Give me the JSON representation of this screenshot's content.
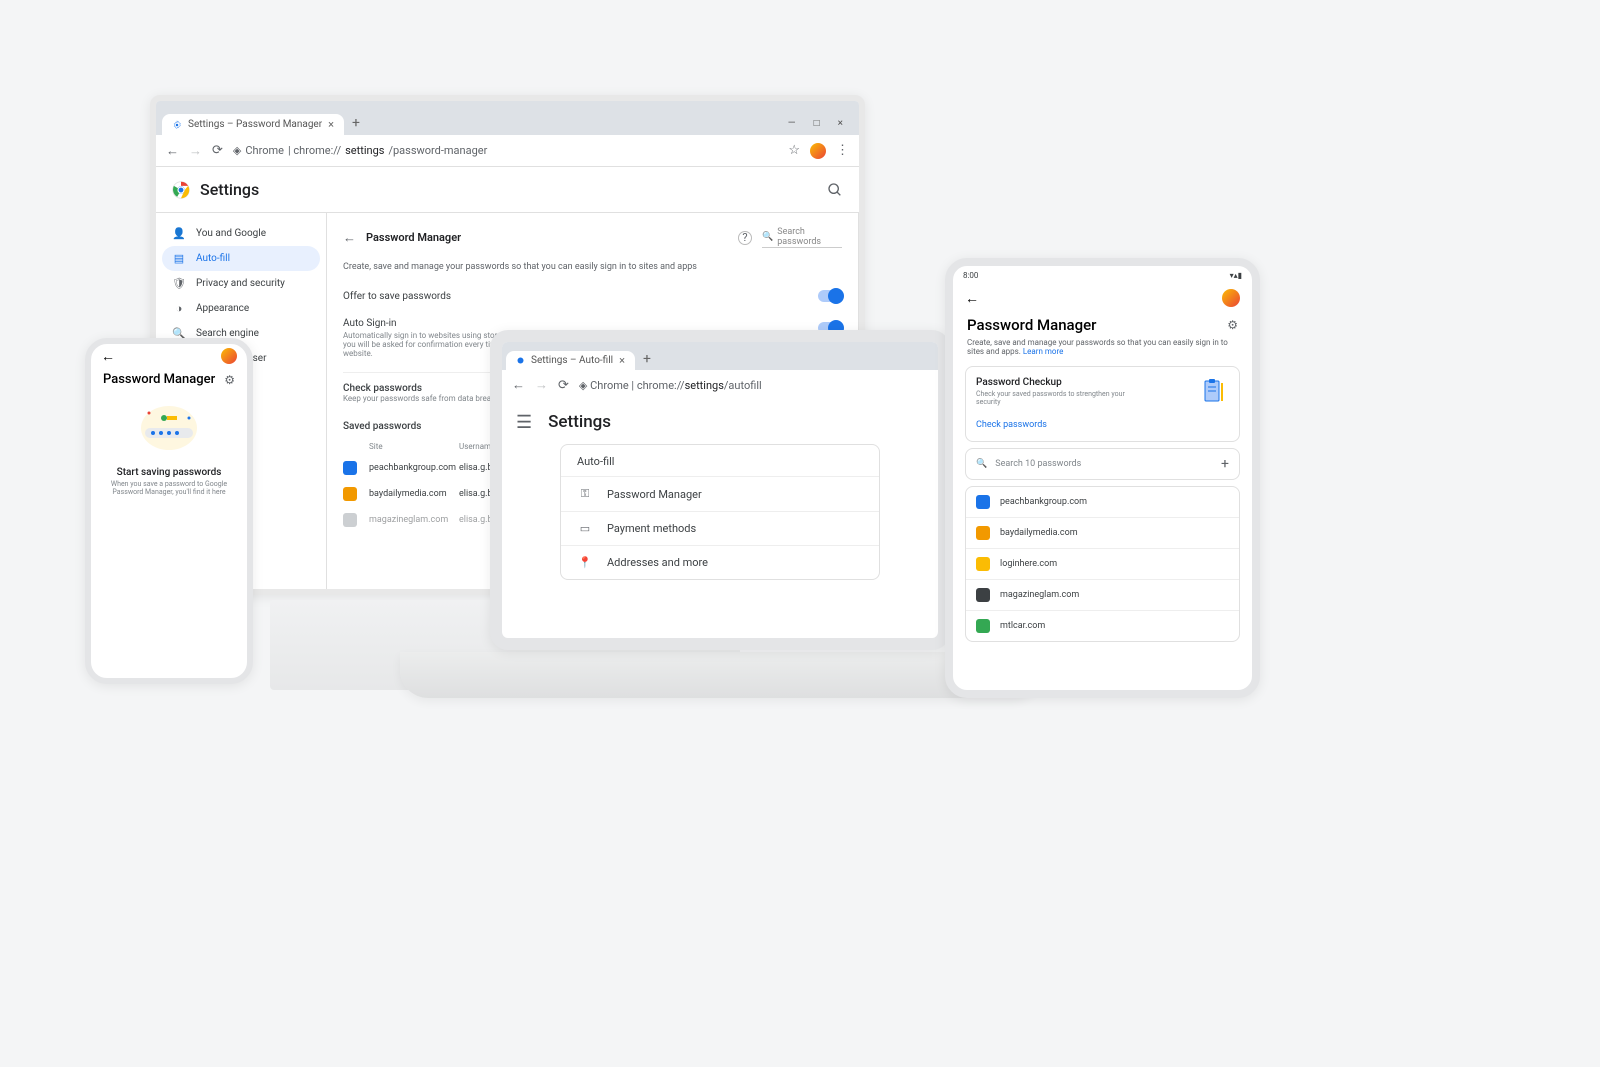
{
  "desktop": {
    "tab_title": "Settings – Password Manager",
    "url_prefix": "Chrome",
    "url_sep": " | chrome://",
    "url_bold": "settings",
    "url_suffix": "/password-manager",
    "app_title": "Settings",
    "sidebar": {
      "items": [
        {
          "icon": "person",
          "label": "You and Google"
        },
        {
          "icon": "autofill",
          "label": "Auto-fill"
        },
        {
          "icon": "shield",
          "label": "Privacy and security"
        },
        {
          "icon": "appearance",
          "label": "Appearance"
        },
        {
          "icon": "search",
          "label": "Search engine"
        },
        {
          "icon": "browser",
          "label": "Default browser"
        }
      ]
    },
    "pm": {
      "title": "Password Manager",
      "search_placeholder": "Search passwords",
      "description": "Create, save and manage your passwords so that you can easily sign in to sites and apps",
      "offer_label": "Offer to save passwords",
      "auto_signin_label": "Auto Sign-in",
      "auto_signin_desc": "Automatically sign in to websites using stored credentials. If disabled, you will be asked for confirmation every time before signing in to a website.",
      "check_title": "Check passwords",
      "check_desc": "Keep your passwords safe from data breaches and",
      "saved_title": "Saved passwords",
      "col_site": "Site",
      "col_user": "Username",
      "rows": [
        {
          "site": "peachbankgroup.com",
          "user": "elisa.g.becket@"
        },
        {
          "site": "baydailymedia.com",
          "user": "elisa.g.becket@"
        },
        {
          "site": "magazineglam.com",
          "user": "elisa.g.becket@"
        }
      ]
    }
  },
  "laptop": {
    "tab_title": "Settings – Auto-fill",
    "url_prefix": "Chrome",
    "url_sep": " | chrome://",
    "url_bold": "settings",
    "url_suffix": "/autofill",
    "app_title": "Settings",
    "card_title": "Auto-fill",
    "items": [
      {
        "label": "Password Manager"
      },
      {
        "label": "Payment methods"
      },
      {
        "label": "Addresses and more"
      }
    ]
  },
  "phone": {
    "title": "Password Manager",
    "headline": "Start saving passwords",
    "sub": "When you save a password to Google Password Manager, you'll find it here"
  },
  "tablet": {
    "time": "8:00",
    "title": "Password Manager",
    "desc": "Create, save and manage your passwords so that you can easily sign in to sites and apps.",
    "learn_more": "Learn more",
    "checkup_title": "Password Checkup",
    "checkup_desc": "Check your saved passwords to strengthen your security",
    "check_link": "Check passwords",
    "search_placeholder": "Search 10 passwords",
    "sites": [
      "peachbankgroup.com",
      "baydailymedia.com",
      "loginhere.com",
      "magazineglam.com",
      "mtlcar.com"
    ]
  }
}
